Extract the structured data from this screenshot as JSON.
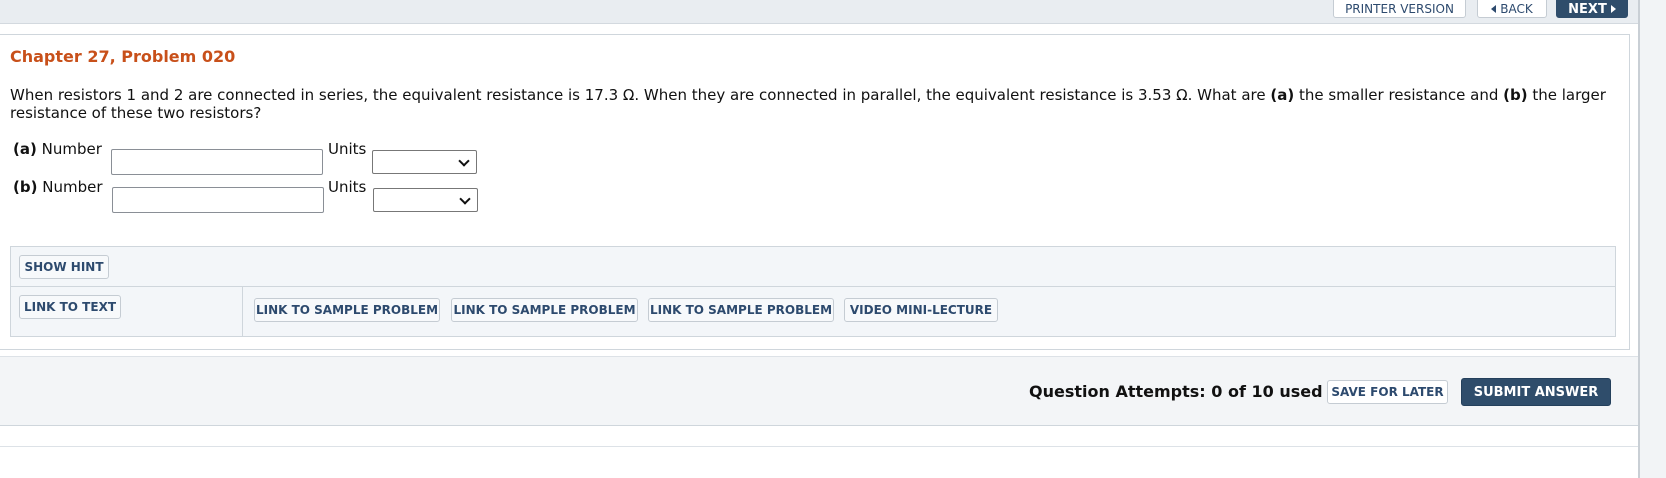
{
  "nav": {
    "printer_label": "PRINTER VERSION",
    "back_label": "BACK",
    "next_label": "NEXT"
  },
  "problem": {
    "title": "Chapter 27, Problem 020",
    "text": "When resistors 1 and 2 are connected in series, the equivalent resistance is 17.3 Ω. When they are connected in parallel, the equivalent resistance is 3.53 Ω. What are (a) the smaller resistance and (b) the larger resistance of these two resistors?"
  },
  "answers": [
    {
      "part": "(a)",
      "number_label": "Number",
      "number_value": "",
      "units_label": "Units",
      "units_value": ""
    },
    {
      "part": "(b)",
      "number_label": "Number",
      "number_value": "",
      "units_label": "Units",
      "units_value": ""
    }
  ],
  "help": {
    "show_hint": "SHOW HINT",
    "link_to_text": "LINK TO TEXT",
    "sample_1": "LINK TO SAMPLE PROBLEM",
    "sample_2": "LINK TO SAMPLE PROBLEM",
    "sample_3": "LINK TO SAMPLE PROBLEM",
    "video": "VIDEO MINI-LECTURE"
  },
  "footer": {
    "attempts": "Question Attempts: 0 of 10 used",
    "save_label": "SAVE FOR LATER",
    "submit_label": "SUBMIT ANSWER"
  },
  "colors": {
    "title": "#c8501a",
    "primary_button": "#2f4d6b",
    "link_text": "#2d4a6e"
  }
}
